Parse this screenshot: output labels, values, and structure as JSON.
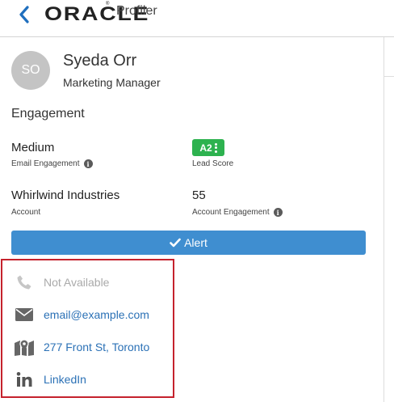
{
  "header": {
    "brand": "ORACLE",
    "registered": "®",
    "product": "Profiler"
  },
  "profile": {
    "initials": "SO",
    "name": "Syeda Orr",
    "title": "Marketing Manager"
  },
  "engagement": {
    "section_title": "Engagement",
    "email_engagement": {
      "value": "Medium",
      "label": "Email Engagement"
    },
    "lead_score": {
      "value": "A2",
      "label": "Lead Score",
      "color": "#2db24f"
    },
    "account": {
      "value": "Whirlwind Industries",
      "label": "Account"
    },
    "account_engagement": {
      "value": "55",
      "label": "Account Engagement"
    }
  },
  "alert": {
    "label": "Alert",
    "color": "#3f8ed0"
  },
  "contact": {
    "phone": "Not Available",
    "email": "email@example.com",
    "address": "277 Front St, Toronto",
    "linkedin": "LinkedIn"
  },
  "colors": {
    "accent": "#2b71b6",
    "highlight_border": "#c5222d"
  }
}
